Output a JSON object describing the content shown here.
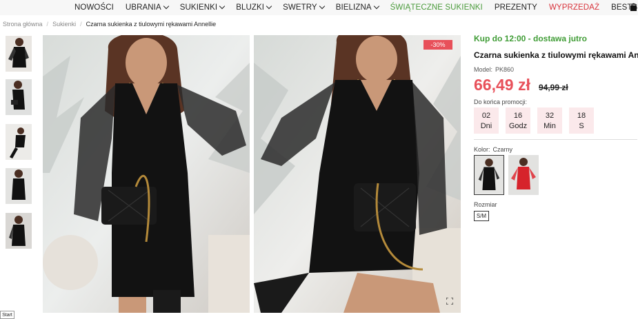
{
  "nav": {
    "items": [
      {
        "label": "NOWOŚCI",
        "dropdown": false,
        "color": "default"
      },
      {
        "label": "UBRANIA",
        "dropdown": true,
        "color": "default"
      },
      {
        "label": "SUKIENKI",
        "dropdown": true,
        "color": "default"
      },
      {
        "label": "BLUZKI",
        "dropdown": true,
        "color": "default"
      },
      {
        "label": "SWETRY",
        "dropdown": true,
        "color": "default"
      },
      {
        "label": "BIELIZNA",
        "dropdown": true,
        "color": "default"
      },
      {
        "label": "ŚWIĄTECZNE SUKIENKI",
        "dropdown": false,
        "color": "green"
      },
      {
        "label": "PREZENTY",
        "dropdown": false,
        "color": "default"
      },
      {
        "label": "WYPRZEDAŻ",
        "dropdown": false,
        "color": "red"
      },
      {
        "label": "BESTSELLERY",
        "dropdown": false,
        "color": "default"
      }
    ],
    "cart_icon": "shopping-bag-icon"
  },
  "breadcrumb": {
    "home": "Strona główna",
    "category": "Sukienki",
    "current": "Czarna sukienka z tiulowymi rękawami Annellie"
  },
  "gallery": {
    "thumbnail_count": 5,
    "discount_badge": "-30%",
    "expand_icon": "fullscreen-icon"
  },
  "product": {
    "delivery": "Kup do 12:00 - dostawa jutro",
    "title": "Czarna sukienka z tiulowymi rękawami Annellie",
    "model_label": "Model:",
    "model_value": "PK860",
    "price": "66,49 zł",
    "old_price": "94,99 zł",
    "promo_label": "Do końca promocji:",
    "countdown": [
      {
        "value": "02",
        "unit": "Dni"
      },
      {
        "value": "16",
        "unit": "Godz"
      },
      {
        "value": "32",
        "unit": "Min"
      },
      {
        "value": "18",
        "unit": "S"
      }
    ],
    "color_label": "Kolor:",
    "color_value": "Czarny",
    "size_label": "Rozmiar",
    "size_value": "S/M"
  },
  "taskbar": {
    "start_label": "Start"
  },
  "colors": {
    "accent_red": "#e8505a",
    "delivery_green": "#3f9c35",
    "nav_green": "#4a9a3a",
    "nav_red": "#d8323a"
  }
}
